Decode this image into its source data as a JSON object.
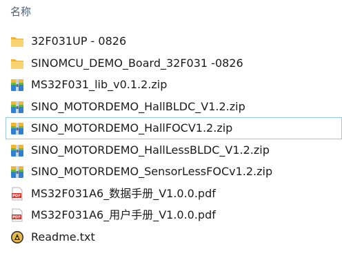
{
  "header": {
    "name_column": "名称"
  },
  "files": [
    {
      "name": "32F031UP - 0826",
      "icon": "folder-icon"
    },
    {
      "name": "SINOMCU_DEMO_Board_32F031 -0826",
      "icon": "folder-icon"
    },
    {
      "name": "MS32F031_lib_v0.1.2.zip",
      "icon": "zip-archive-icon"
    },
    {
      "name": "SINO_MOTORDEMO_HallBLDC_V1.2.zip",
      "icon": "zip-archive-icon"
    },
    {
      "name": "SINO_MOTORDEMO_HallFOCV1.2.zip",
      "icon": "zip-archive-icon"
    },
    {
      "name": "SINO_MOTORDEMO_HallLessBLDC_V1.2.zip",
      "icon": "zip-archive-icon"
    },
    {
      "name": "SINO_MOTORDEMO_SensorLessFOCv1.2.zip",
      "icon": "zip-archive-icon"
    },
    {
      "name": "MS32F031A6_数据手册_V1.0.0.pdf",
      "icon": "pdf-file-icon"
    },
    {
      "name": "MS32F031A6_用户手册_V1.0.0.pdf",
      "icon": "pdf-file-icon"
    },
    {
      "name": "Readme.txt",
      "icon": "text-file-icon"
    }
  ],
  "colors": {
    "folder": "#f5c542",
    "pdf": "#d93025",
    "selection_border": "#99c9ef",
    "header_text": "#4c607a"
  }
}
